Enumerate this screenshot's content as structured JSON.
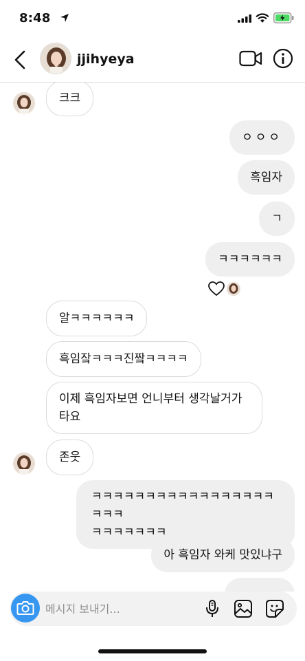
{
  "status_bar": {
    "time": "8:48"
  },
  "header": {
    "username": "jjihyeya"
  },
  "messages": [
    {
      "side": "in",
      "text": "크크"
    },
    {
      "side": "out",
      "text": "ㅇㅇㅇ"
    },
    {
      "side": "out",
      "text": "흑임자"
    },
    {
      "side": "out",
      "text": "ㄱ"
    },
    {
      "side": "out",
      "text": "ㅋㅋㅋㅋㅋㅋ"
    },
    {
      "side": "in",
      "text": "알ㅋㅋㅋㅋㅋㅋ"
    },
    {
      "side": "in",
      "text": "흑임잨ㅋㅋㅋ진짴ㅋㅋㅋㅋ"
    },
    {
      "side": "in",
      "text": "이제 흑임자보면 언니부터 생각날거가",
      "text_line2": "타요"
    },
    {
      "side": "in",
      "text": "존웃"
    },
    {
      "side": "out",
      "text": "ㅋㅋㅋㅋㅋㅋㅋㅋㅋㅋㅋㅋㅋㅋㅋㅋㅋㅋㅋㅋ",
      "text_line2": "ㅋㅋㅋㅋㅋㅋㅋ"
    },
    {
      "side": "out",
      "text": "아 흑임자 와케 맛있냐구"
    }
  ],
  "composer": {
    "placeholder": "메시지 보내기..."
  },
  "icons": {
    "back": "chevron-left-icon",
    "video": "video-camera-icon",
    "info": "info-icon",
    "camera": "camera-icon",
    "mic": "microphone-icon",
    "gallery": "image-gallery-icon",
    "sticker": "sticker-icon",
    "reaction": "heart-icon"
  },
  "colors": {
    "accent_blue": "#3797f0",
    "outgoing_bubble": "#efefef",
    "incoming_border": "#dbdbdb",
    "battery_green": "#4cd964"
  }
}
